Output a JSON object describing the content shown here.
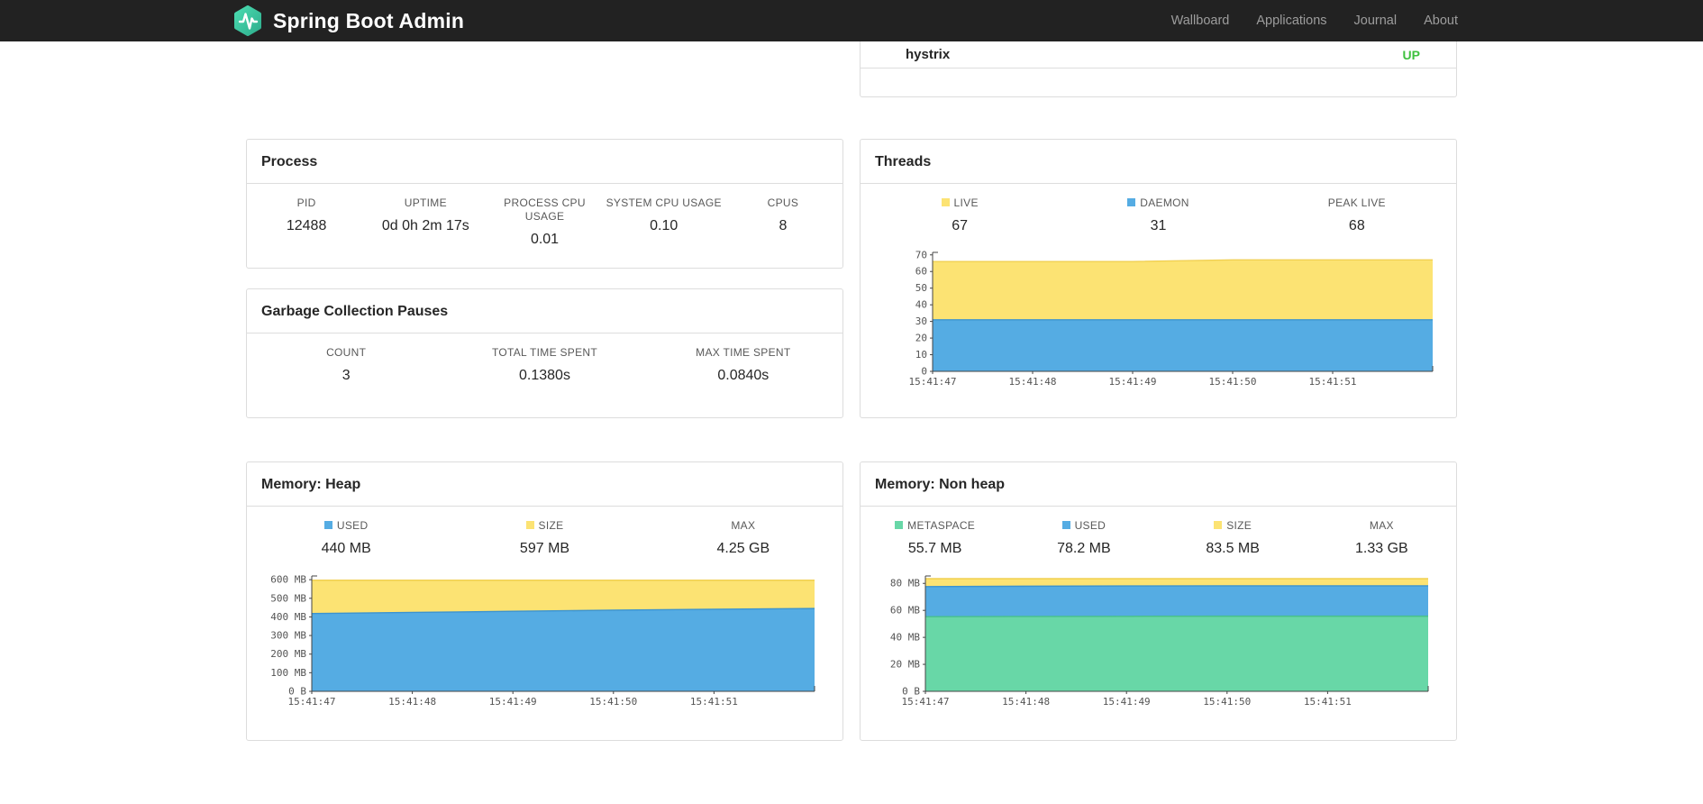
{
  "navbar": {
    "brand": "Spring Boot Admin",
    "links": [
      {
        "label": "Wallboard"
      },
      {
        "label": "Applications"
      },
      {
        "label": "Journal"
      },
      {
        "label": "About"
      }
    ]
  },
  "colors": {
    "navbar_bg": "#222222",
    "logo_teal": "#3cc9a4",
    "status_up": "#3fc13f",
    "series_blue": "#55ace3",
    "series_yellow": "#fce373",
    "series_green": "#68d7a7"
  },
  "health_panel": {
    "row_label": "hystrix",
    "row_status": "UP",
    "status_color": "#3fc13f"
  },
  "panels": {
    "process": {
      "title": "Process",
      "stats": [
        {
          "label": "PID",
          "value": "12488"
        },
        {
          "label": "UPTIME",
          "value": "0d 0h 2m 17s"
        },
        {
          "label": "PROCESS CPU USAGE",
          "value": "0.01"
        },
        {
          "label": "SYSTEM CPU USAGE",
          "value": "0.10"
        },
        {
          "label": "CPUS",
          "value": "8"
        }
      ]
    },
    "gc": {
      "title": "Garbage Collection Pauses",
      "stats": [
        {
          "label": "COUNT",
          "value": "3"
        },
        {
          "label": "TOTAL TIME SPENT",
          "value": "0.1380s"
        },
        {
          "label": "MAX TIME SPENT",
          "value": "0.0840s"
        }
      ]
    },
    "threads": {
      "title": "Threads",
      "stats": [
        {
          "label": "LIVE",
          "value": "67",
          "swatch": "#fce373"
        },
        {
          "label": "DAEMON",
          "value": "31",
          "swatch": "#55ace3"
        },
        {
          "label": "PEAK LIVE",
          "value": "68"
        }
      ]
    },
    "heap": {
      "title": "Memory: Heap",
      "stats": [
        {
          "label": "USED",
          "value": "440 MB",
          "swatch": "#55ace3"
        },
        {
          "label": "SIZE",
          "value": "597 MB",
          "swatch": "#fce373"
        },
        {
          "label": "MAX",
          "value": "4.25 GB"
        }
      ]
    },
    "nonheap": {
      "title": "Memory: Non heap",
      "stats": [
        {
          "label": "METASPACE",
          "value": "55.7 MB",
          "swatch": "#68d7a7"
        },
        {
          "label": "USED",
          "value": "78.2 MB",
          "swatch": "#55ace3"
        },
        {
          "label": "SIZE",
          "value": "83.5 MB",
          "swatch": "#fce373"
        },
        {
          "label": "MAX",
          "value": "1.33 GB"
        }
      ]
    }
  },
  "chart_data": [
    {
      "type": "area",
      "title": "Threads",
      "xlabel": "",
      "ylabel": "",
      "grid": false,
      "legend_position": "top",
      "x_labels": [
        "15:41:47",
        "15:41:48",
        "15:41:49",
        "15:41:50",
        "15:41:51"
      ],
      "y_max": 71.5,
      "y_ticks": [
        {
          "v": 0,
          "label": "0"
        },
        {
          "v": 10,
          "label": "10"
        },
        {
          "v": 20,
          "label": "20"
        },
        {
          "v": 30,
          "label": "30"
        },
        {
          "v": 40,
          "label": "40"
        },
        {
          "v": 50,
          "label": "50"
        },
        {
          "v": 60,
          "label": "60"
        },
        {
          "v": 70,
          "label": "70"
        }
      ],
      "series": [
        {
          "name": "LIVE",
          "fill": "#fce373",
          "line": "#f1d052",
          "values": [
            66,
            66,
            66,
            67,
            67,
            67
          ]
        },
        {
          "name": "DAEMON",
          "fill": "#55ace3",
          "line": "#3c93cf",
          "values": [
            31,
            31,
            31,
            31,
            31,
            31
          ]
        }
      ]
    },
    {
      "type": "area",
      "title": "Memory: Heap",
      "xlabel": "",
      "ylabel": "",
      "grid": false,
      "legend_position": "top",
      "x_labels": [
        "15:41:47",
        "15:41:48",
        "15:41:49",
        "15:41:50",
        "15:41:51"
      ],
      "y_max": 620,
      "y_ticks": [
        {
          "v": 0,
          "label": "0 B"
        },
        {
          "v": 100,
          "label": "100 MB"
        },
        {
          "v": 200,
          "label": "200 MB"
        },
        {
          "v": 300,
          "label": "300 MB"
        },
        {
          "v": 400,
          "label": "400 MB"
        },
        {
          "v": 500,
          "label": "500 MB"
        },
        {
          "v": 600,
          "label": "600 MB"
        }
      ],
      "series": [
        {
          "name": "SIZE",
          "fill": "#fce373",
          "line": "#f1d052",
          "values": [
            597,
            597,
            597,
            597,
            597,
            597
          ]
        },
        {
          "name": "USED",
          "fill": "#55ace3",
          "line": "#3c93cf",
          "values": [
            418,
            424,
            430,
            436,
            441,
            445
          ]
        }
      ]
    },
    {
      "type": "area",
      "title": "Memory: Non heap",
      "xlabel": "",
      "ylabel": "",
      "grid": false,
      "legend_position": "top",
      "x_labels": [
        "15:41:47",
        "15:41:48",
        "15:41:49",
        "15:41:50",
        "15:41:51"
      ],
      "y_max": 85.5,
      "y_ticks": [
        {
          "v": 0,
          "label": "0 B"
        },
        {
          "v": 20,
          "label": "20 MB"
        },
        {
          "v": 40,
          "label": "40 MB"
        },
        {
          "v": 60,
          "label": "60 MB"
        },
        {
          "v": 80,
          "label": "80 MB"
        }
      ],
      "series": [
        {
          "name": "SIZE",
          "fill": "#fce373",
          "line": "#f1d052",
          "values": [
            83.5,
            83.5,
            83.5,
            83.5,
            83.5,
            83.5
          ]
        },
        {
          "name": "USED",
          "fill": "#55ace3",
          "line": "#3c93cf",
          "values": [
            77.6,
            77.9,
            78.1,
            78.2,
            78.2,
            78.2
          ]
        },
        {
          "name": "METASPACE",
          "fill": "#68d7a7",
          "line": "#47c08c",
          "values": [
            55.3,
            55.5,
            55.6,
            55.7,
            55.7,
            55.7
          ]
        }
      ]
    }
  ]
}
